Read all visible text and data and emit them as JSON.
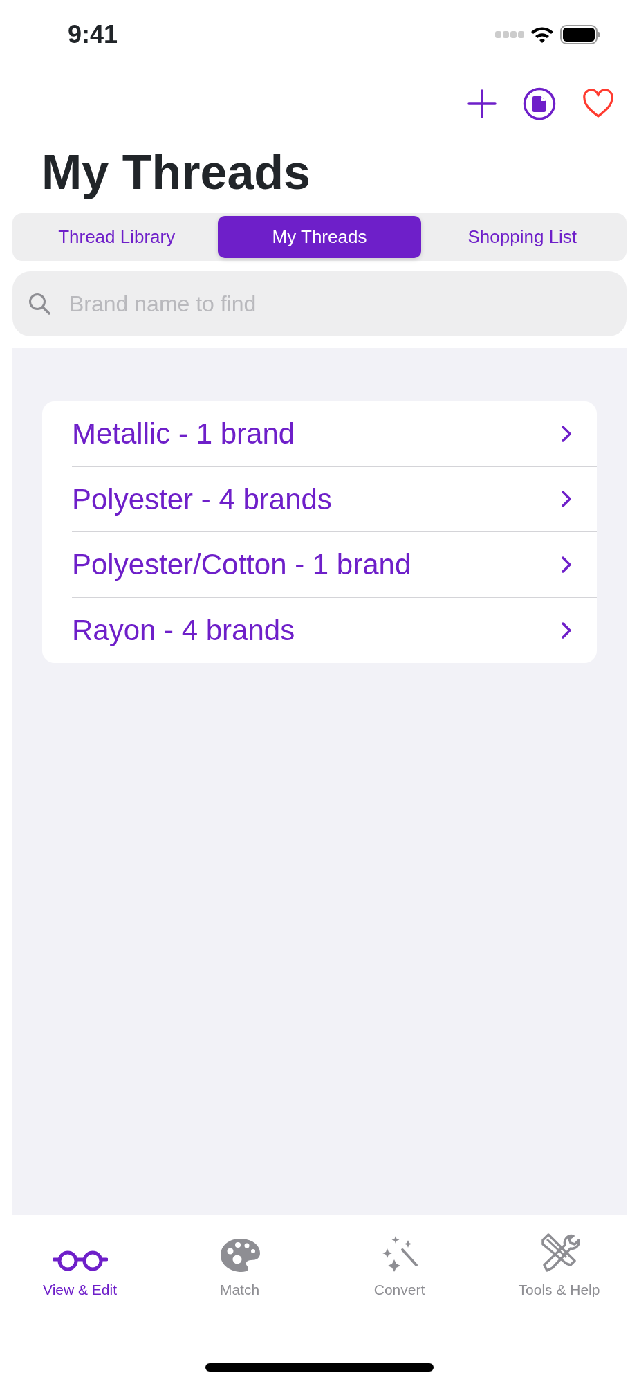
{
  "status_bar": {
    "time": "9:41"
  },
  "toolbar": [
    {
      "kind": "add"
    },
    {
      "kind": "document"
    },
    {
      "kind": "favorite"
    }
  ],
  "title": "My Threads",
  "segments": [
    {
      "label": "Thread Library",
      "selected": false
    },
    {
      "label": "My Threads",
      "selected": true
    },
    {
      "label": "Shopping List",
      "selected": false
    }
  ],
  "search": {
    "placeholder": "Brand name to find"
  },
  "categories": [
    {
      "label": "Metallic - 1 brand"
    },
    {
      "label": "Polyester - 4 brands"
    },
    {
      "label": "Polyester/Cotton - 1 brand"
    },
    {
      "label": "Rayon - 4 brands"
    }
  ],
  "tab_bar": [
    {
      "kind": "glasses",
      "label": "View & Edit",
      "selected": true
    },
    {
      "kind": "palette",
      "label": "Match",
      "selected": false
    },
    {
      "kind": "wand",
      "label": "Convert",
      "selected": false
    },
    {
      "kind": "tools",
      "label": "Tools & Help",
      "selected": false
    }
  ]
}
